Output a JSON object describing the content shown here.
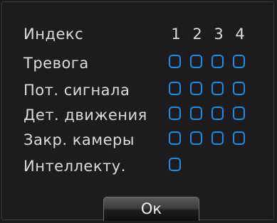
{
  "header": {
    "index_label": "Индекс",
    "columns": [
      "1",
      "2",
      "3",
      "4"
    ]
  },
  "rows": [
    {
      "label": "Тревога",
      "checkboxes": [
        false,
        false,
        false,
        false
      ]
    },
    {
      "label": "Пот. сигнала",
      "checkboxes": [
        false,
        false,
        false,
        false
      ]
    },
    {
      "label": "Дет. движения",
      "checkboxes": [
        false,
        false,
        false,
        false
      ]
    },
    {
      "label": "Закр. камеры",
      "checkboxes": [
        false,
        false,
        false,
        false
      ]
    },
    {
      "label": "Интеллекту.",
      "checkboxes": [
        false
      ]
    }
  ],
  "buttons": {
    "ok_label": "Ок"
  },
  "colors": {
    "accent": "#1a8fe3",
    "background": "#1d1b1d",
    "text": "#dcdcdc"
  }
}
